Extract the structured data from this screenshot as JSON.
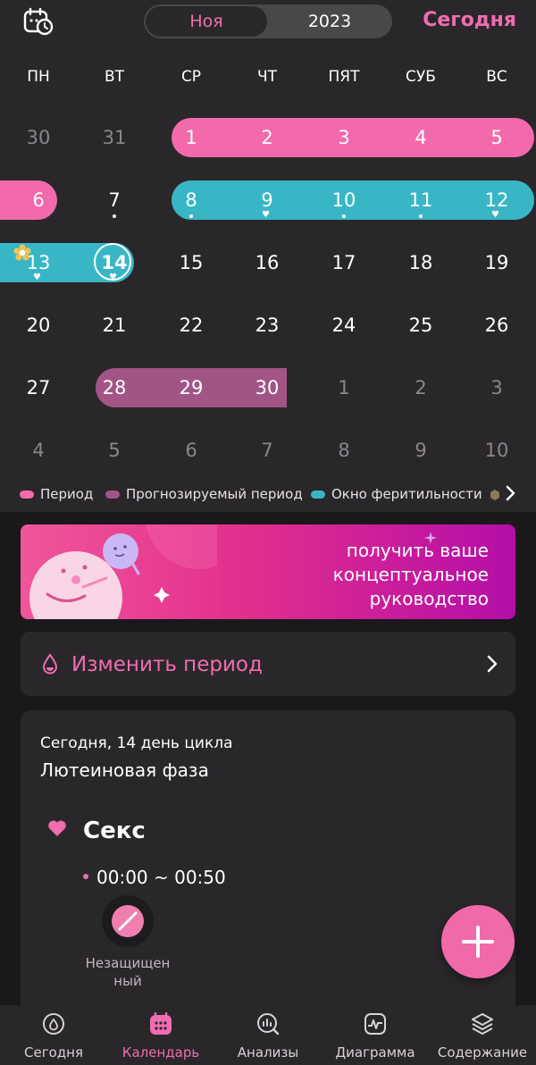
{
  "header": {
    "month": "Ноя",
    "year": "2023",
    "today_button": "Сегодня",
    "calendar_icon": "calendar-clock-icon"
  },
  "weekdays": [
    "ПН",
    "ВТ",
    "СР",
    "ЧТ",
    "ПЯТ",
    "СУБ",
    "ВС"
  ],
  "calendar": {
    "rows": [
      [
        "30",
        "31",
        "1",
        "2",
        "3",
        "4",
        "5"
      ],
      [
        "6",
        "7",
        "8",
        "9",
        "10",
        "11",
        "12"
      ],
      [
        "13",
        "14",
        "15",
        "16",
        "17",
        "18",
        "19"
      ],
      [
        "20",
        "21",
        "22",
        "23",
        "24",
        "25",
        "26"
      ],
      [
        "27",
        "28",
        "29",
        "30",
        "1",
        "2",
        "3"
      ],
      [
        "4",
        "5",
        "6",
        "7",
        "8",
        "9",
        "10"
      ]
    ],
    "today": "14"
  },
  "legend": {
    "period": "Период",
    "predicted": "Прогнозируемый период",
    "fertile": "Окно феритильности"
  },
  "colors": {
    "period": "#f26aab",
    "predicted": "#a25585",
    "fertile": "#39b6c6",
    "accent": "#f06db0",
    "background": "#2a272b"
  },
  "banner": {
    "line1": "получить ваше",
    "line2": "концептуальное",
    "line3": "руководство"
  },
  "period_card": {
    "label": "Изменить период"
  },
  "info": {
    "cycle_day": "Сегодня, 14 день цикла",
    "phase": "Лютеиновая фаза",
    "sex_title": "Секс",
    "time": "00:00 ~ 00:50",
    "protection_line1": "Незащищен",
    "protection_line2": "ный"
  },
  "tabs": [
    {
      "label": "Сегодня",
      "icon": "today-icon"
    },
    {
      "label": "Календарь",
      "icon": "calendar-icon"
    },
    {
      "label": "Анализы",
      "icon": "analysis-icon"
    },
    {
      "label": "Диаграмма",
      "icon": "chart-icon"
    },
    {
      "label": "Содержание",
      "icon": "content-icon"
    }
  ],
  "active_tab": "Календарь"
}
